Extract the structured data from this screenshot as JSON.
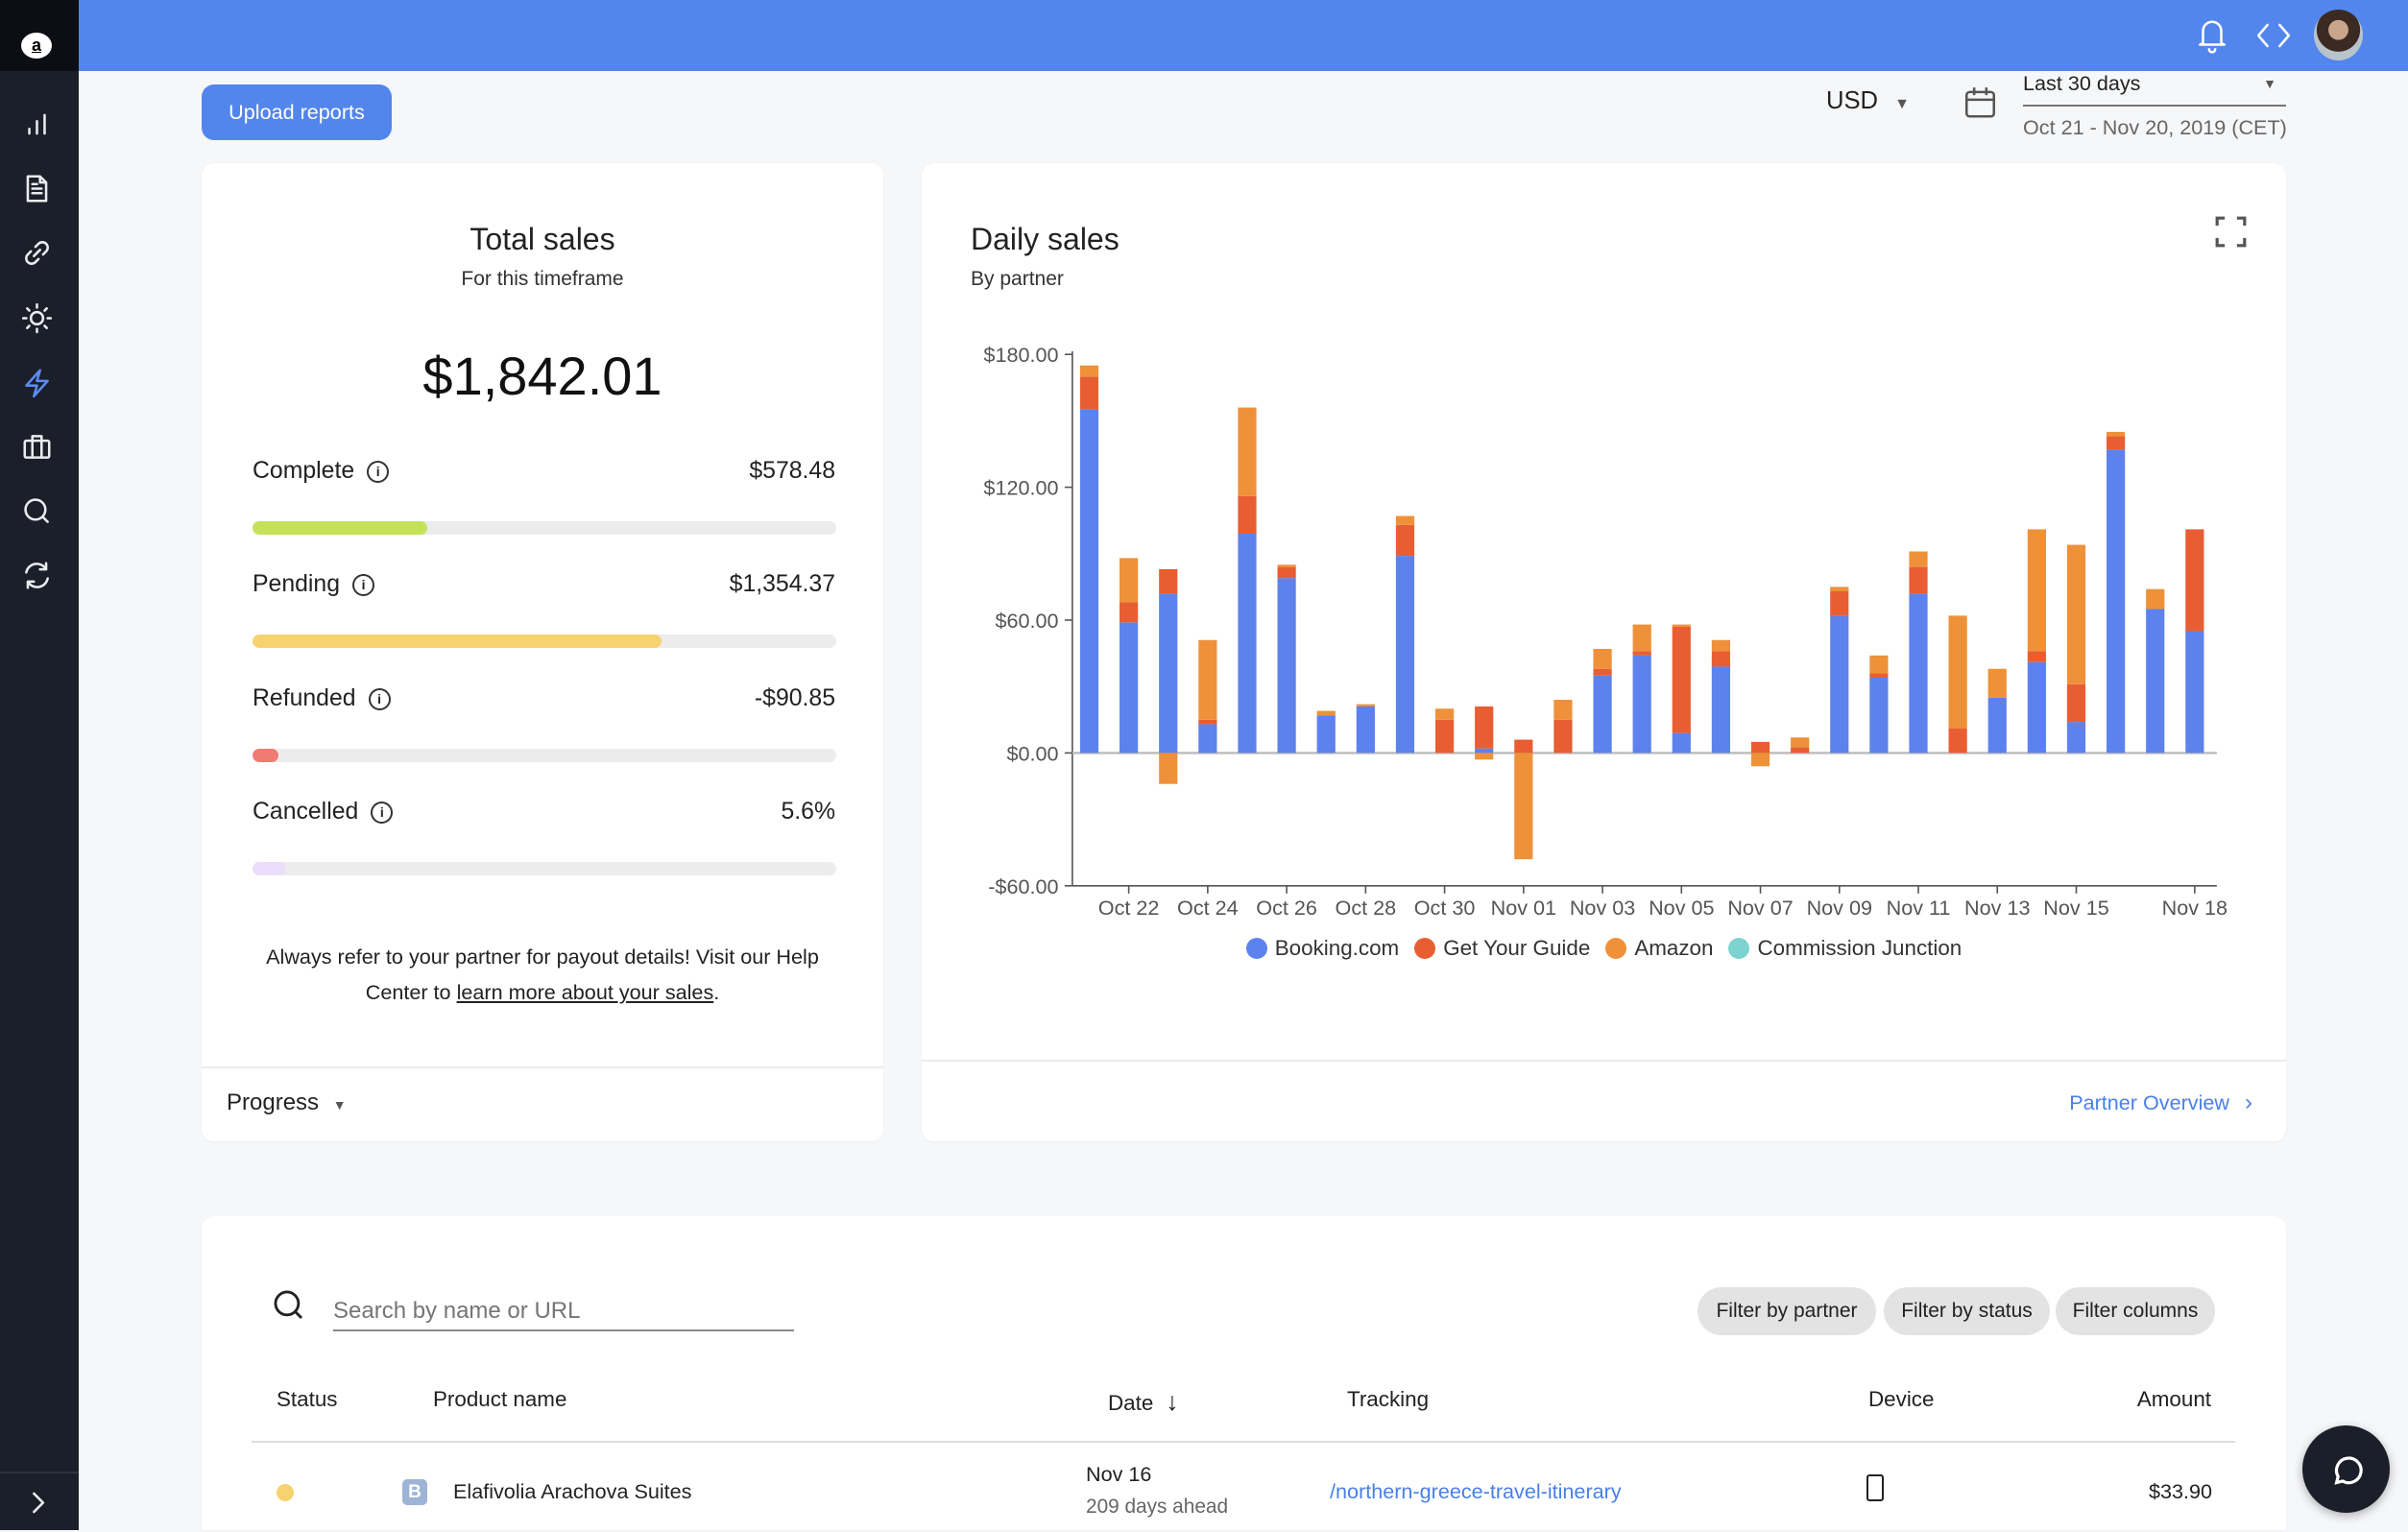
{
  "sidebar": {
    "logo": "a",
    "items": [
      {
        "icon": "bar-chart-icon"
      },
      {
        "icon": "document-icon"
      },
      {
        "icon": "link-icon"
      },
      {
        "icon": "sun-icon"
      },
      {
        "icon": "lightning-icon",
        "active": true
      },
      {
        "icon": "briefcase-icon"
      },
      {
        "icon": "search-icon"
      },
      {
        "icon": "refresh-icon"
      }
    ],
    "expand_icon": "chevron-right-icon"
  },
  "topbar": {
    "icons": [
      "bell-icon",
      "code-icon",
      "avatar"
    ]
  },
  "toolbar": {
    "upload_label": "Upload reports",
    "currency": "USD",
    "date_range_label": "Last 30 days",
    "date_range_detail": "Oct 21 - Nov 20, 2019 (CET)"
  },
  "total_sales": {
    "title": "Total sales",
    "subtitle": "For this timeframe",
    "amount": "$1,842.01",
    "rows": [
      {
        "label": "Complete",
        "value": "$578.48",
        "progress": 0.3,
        "color": "#c3e25a"
      },
      {
        "label": "Pending",
        "value": "$1,354.37",
        "progress": 0.7,
        "color": "#f7d370"
      },
      {
        "label": "Refunded",
        "value": "-$90.85",
        "progress": 0.045,
        "color": "#ef7b73"
      },
      {
        "label": "Cancelled",
        "value": "5.6%",
        "progress": 0.056,
        "color": "#ecdcfb"
      }
    ],
    "note_prefix": "Always refer to your partner for payout details! Visit our Help Center to ",
    "note_link": "learn more about your sales",
    "note_suffix": ".",
    "footer_select": "Progress"
  },
  "daily_sales": {
    "title": "Daily sales",
    "subtitle": "By partner",
    "footer_link": "Partner Overview"
  },
  "chart_data": {
    "type": "bar",
    "stacked": true,
    "title": "Daily sales",
    "subtitle": "By partner",
    "categories": [
      "Oct 21",
      "Oct 22",
      "Oct 23",
      "Oct 24",
      "Oct 25",
      "Oct 26",
      "Oct 27",
      "Oct 28",
      "Oct 29",
      "Oct 30",
      "Oct 31",
      "Nov 01",
      "Nov 02",
      "Nov 03",
      "Nov 04",
      "Nov 05",
      "Nov 06",
      "Nov 07",
      "Nov 08",
      "Nov 09",
      "Nov 10",
      "Nov 11",
      "Nov 12",
      "Nov 13",
      "Nov 14",
      "Nov 15",
      "Nov 16",
      "Nov 17",
      "Nov 18"
    ],
    "x_tick_labels": [
      "Oct 22",
      "Oct 24",
      "Oct 26",
      "Oct 28",
      "Oct 30",
      "Nov 01",
      "Nov 03",
      "Nov 05",
      "Nov 07",
      "Nov 09",
      "Nov 11",
      "Nov 13",
      "Nov 15",
      "Nov 18"
    ],
    "y_tick_labels": [
      "$180.00",
      "$120.00",
      "$60.00",
      "$0.00",
      "-$60.00"
    ],
    "y_ticks": [
      180,
      120,
      60,
      0,
      -60
    ],
    "ylim": [
      -60,
      180
    ],
    "grid": false,
    "legend_position": "bottom",
    "series": [
      {
        "name": "Booking.com",
        "color": "#5d82ee",
        "values": [
          155,
          59,
          72,
          13,
          99,
          79,
          17,
          21,
          89,
          0,
          2,
          0,
          0,
          35,
          44,
          9,
          39,
          0,
          0,
          62,
          34,
          72,
          0,
          25,
          41,
          14,
          137,
          65,
          55
        ]
      },
      {
        "name": "Get Your Guide",
        "color": "#e85e32",
        "values": [
          15,
          9,
          11,
          2,
          17,
          5,
          0,
          0,
          14,
          15,
          19,
          6,
          15,
          3,
          2,
          48,
          7,
          5,
          2.5,
          11,
          2,
          12,
          11,
          0,
          5,
          17,
          6,
          0,
          46
        ]
      },
      {
        "name": "Amazon",
        "color": "#ee9139",
        "values": [
          5,
          20,
          -14,
          36,
          40,
          1,
          2,
          1,
          4,
          5,
          -3,
          -48,
          9,
          9,
          12,
          1,
          5,
          -6,
          4.5,
          2,
          8,
          7,
          51,
          13,
          55,
          63,
          2,
          9,
          0
        ]
      },
      {
        "name": "Commission Junction",
        "color": "#7dd3cf",
        "values": [
          0,
          0,
          0,
          0,
          0,
          0,
          0,
          0,
          0,
          0,
          0,
          0,
          0,
          0,
          0,
          0,
          0,
          0,
          0,
          0,
          0,
          0,
          0,
          0,
          0,
          0,
          0,
          0,
          0
        ]
      }
    ]
  },
  "table": {
    "search_placeholder": "Search by name or URL",
    "filters": [
      "Filter by partner",
      "Filter by status",
      "Filter columns"
    ],
    "columns": [
      "Status",
      "Product name",
      "Date",
      "Tracking",
      "Device",
      "Amount"
    ],
    "rows": [
      {
        "status_color": "#f7d370",
        "partner_badge": "B",
        "product": "Elafivolia Arachova Suites",
        "date": "Nov 16",
        "date_sub": "209 days ahead",
        "tracking": "/northern-greece-travel-itinerary",
        "device": "mobile-icon",
        "amount": "$33.90"
      }
    ]
  }
}
